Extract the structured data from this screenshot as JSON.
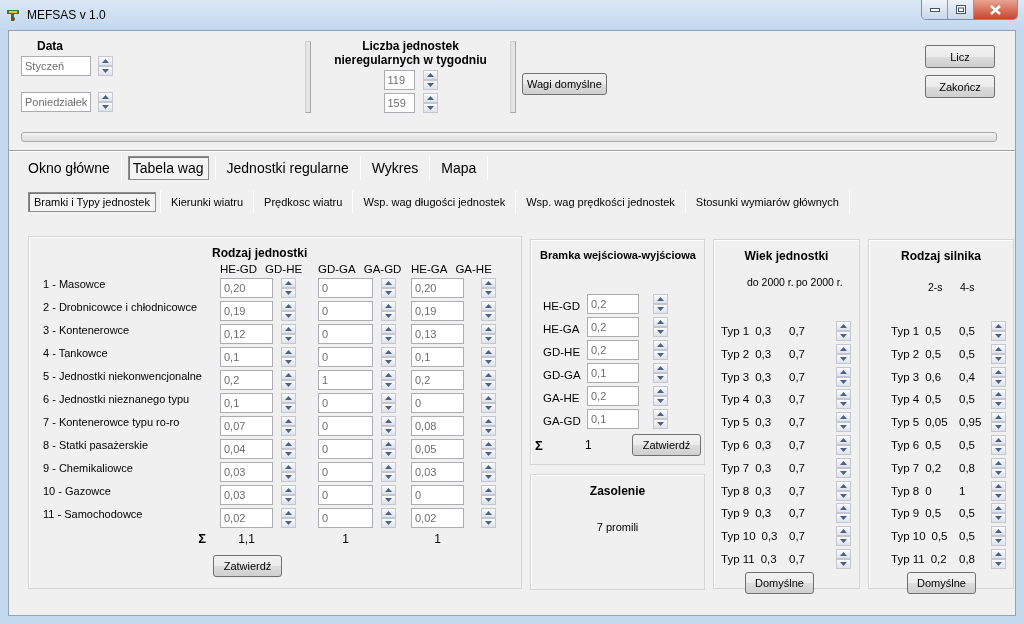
{
  "window": {
    "title": "MEFSAS v 1.0"
  },
  "date": {
    "title": "Data",
    "fields": [
      "Styczeń",
      "Poniedziałek"
    ]
  },
  "irregular": {
    "title": "Liczba jednostek nieregularnych w tygodniu",
    "fields": [
      "119",
      "159"
    ]
  },
  "default_weights_button": "Wagi domyślne",
  "side_buttons": [
    "Licz",
    "Zakończ"
  ],
  "progress": {
    "level": 0
  },
  "tabs": [
    {
      "label": "Okno główne",
      "selected": false
    },
    {
      "label": "Tabela wag",
      "selected": true
    },
    {
      "label": "Jednostki regularne",
      "selected": false
    },
    {
      "label": "Wykres",
      "selected": false
    },
    {
      "label": "Mapa",
      "selected": false
    }
  ],
  "subtabs": [
    {
      "label": "Bramki i Typy jednostek",
      "selected": true
    },
    {
      "label": "Kierunki wiatru",
      "selected": false
    },
    {
      "label": "Prędkosc wiatru",
      "selected": false
    },
    {
      "label": "Wsp. wag długości jednostek",
      "selected": false
    },
    {
      "label": "Wsp. wag prędkości jednostek",
      "selected": false
    },
    {
      "label": "Stosunki wymiarów głównych",
      "selected": false
    }
  ],
  "units": {
    "title": "Rodzaj jednostki",
    "columns": [
      "HE-GD",
      "GD-HE",
      "GD-GA",
      "GA-GD",
      "HE-GA",
      "GA-HE"
    ],
    "rows": [
      {
        "label": "1 - Masowce",
        "values": [
          "0,20",
          "0",
          "0,20"
        ]
      },
      {
        "label": "2 - Drobnicowce i chłodnicowce",
        "values": [
          "0,19",
          "0",
          "0,19"
        ]
      },
      {
        "label": "3 - Kontenerowce",
        "values": [
          "0,12",
          "0",
          "0,13"
        ]
      },
      {
        "label": "4 - Tankowce",
        "values": [
          "0,1",
          "0",
          "0,1"
        ]
      },
      {
        "label": "5 - Jednostki niekonwencjonalne",
        "values": [
          "0,2",
          "1",
          "0,2"
        ]
      },
      {
        "label": "6 - Jednostki nieznanego typu",
        "values": [
          "0,1",
          "0",
          "0"
        ]
      },
      {
        "label": "7 - Kontenerowce typu ro-ro",
        "values": [
          "0,07",
          "0",
          "0,08"
        ]
      },
      {
        "label": "8 - Statki pasażerskie",
        "values": [
          "0,04",
          "0",
          "0,05"
        ]
      },
      {
        "label": "9 - Chemikaliowce",
        "values": [
          "0,03",
          "0",
          "0,03"
        ]
      },
      {
        "label": "10 - Gazowce",
        "values": [
          "0,03",
          "0",
          "0"
        ]
      },
      {
        "label": "11 - Samochodowce",
        "values": [
          "0,02",
          "0",
          "0,02"
        ]
      }
    ],
    "sum_symbol": "Σ",
    "sums": [
      "1,1",
      "1",
      "1"
    ],
    "button": "Zatwierdź"
  },
  "gate": {
    "title": "Bramka wejściowa-wyjściowa",
    "rows": [
      {
        "label": "HE-GD",
        "value": "0,2"
      },
      {
        "label": "HE-GA",
        "value": "0,2"
      },
      {
        "label": "GD-HE",
        "value": "0,2"
      },
      {
        "label": "GD-GA",
        "value": "0,1"
      },
      {
        "label": "GA-HE",
        "value": "0,2"
      },
      {
        "label": "GA-GD",
        "value": "0,1"
      }
    ],
    "sum_symbol": "Σ",
    "sum": "1",
    "button": "Zatwierdź"
  },
  "salinity": {
    "title": "Zasolenie",
    "value": "7 promili"
  },
  "age": {
    "title": "Wiek jednostki",
    "columns": [
      "do 2000 r.",
      "po 2000 r."
    ],
    "rows": [
      {
        "label": "Typ 1",
        "values": [
          "0,3",
          "0,7"
        ]
      },
      {
        "label": "Typ 2",
        "values": [
          "0,3",
          "0,7"
        ]
      },
      {
        "label": "Typ 3",
        "values": [
          "0,3",
          "0,7"
        ]
      },
      {
        "label": "Typ 4",
        "values": [
          "0,3",
          "0,7"
        ]
      },
      {
        "label": "Typ 5",
        "values": [
          "0,3",
          "0,7"
        ]
      },
      {
        "label": "Typ 6",
        "values": [
          "0,3",
          "0,7"
        ]
      },
      {
        "label": "Typ 7",
        "values": [
          "0,3",
          "0,7"
        ]
      },
      {
        "label": "Typ 8",
        "values": [
          "0,3",
          "0,7"
        ]
      },
      {
        "label": "Typ 9",
        "values": [
          "0,3",
          "0,7"
        ]
      },
      {
        "label": "Typ 10",
        "values": [
          "0,3",
          "0,7"
        ]
      },
      {
        "label": "Typ 11",
        "values": [
          "0,3",
          "0,7"
        ]
      }
    ],
    "button": "Domyślne"
  },
  "engine": {
    "title": "Rodzaj silnika",
    "columns": [
      "2-s",
      "4-s"
    ],
    "rows": [
      {
        "label": "Typ 1",
        "values": [
          "0,5",
          "0,5"
        ]
      },
      {
        "label": "Typ 2",
        "values": [
          "0,5",
          "0,5"
        ]
      },
      {
        "label": "Typ 3",
        "values": [
          "0,6",
          "0,4"
        ]
      },
      {
        "label": "Typ 4",
        "values": [
          "0,5",
          "0,5"
        ]
      },
      {
        "label": "Typ 5",
        "values": [
          "0,05",
          "0,95"
        ]
      },
      {
        "label": "Typ 6",
        "values": [
          "0,5",
          "0,5"
        ]
      },
      {
        "label": "Typ 7",
        "values": [
          "0,2",
          "0,8"
        ]
      },
      {
        "label": "Typ 8",
        "values": [
          "0",
          "1"
        ]
      },
      {
        "label": "Typ 9",
        "values": [
          "0,5",
          "0,5"
        ]
      },
      {
        "label": "Typ 10",
        "values": [
          "0,5",
          "0,5"
        ]
      },
      {
        "label": "Typ 11",
        "values": [
          "0,2",
          "0,8"
        ]
      }
    ],
    "button": "Domyślne"
  }
}
